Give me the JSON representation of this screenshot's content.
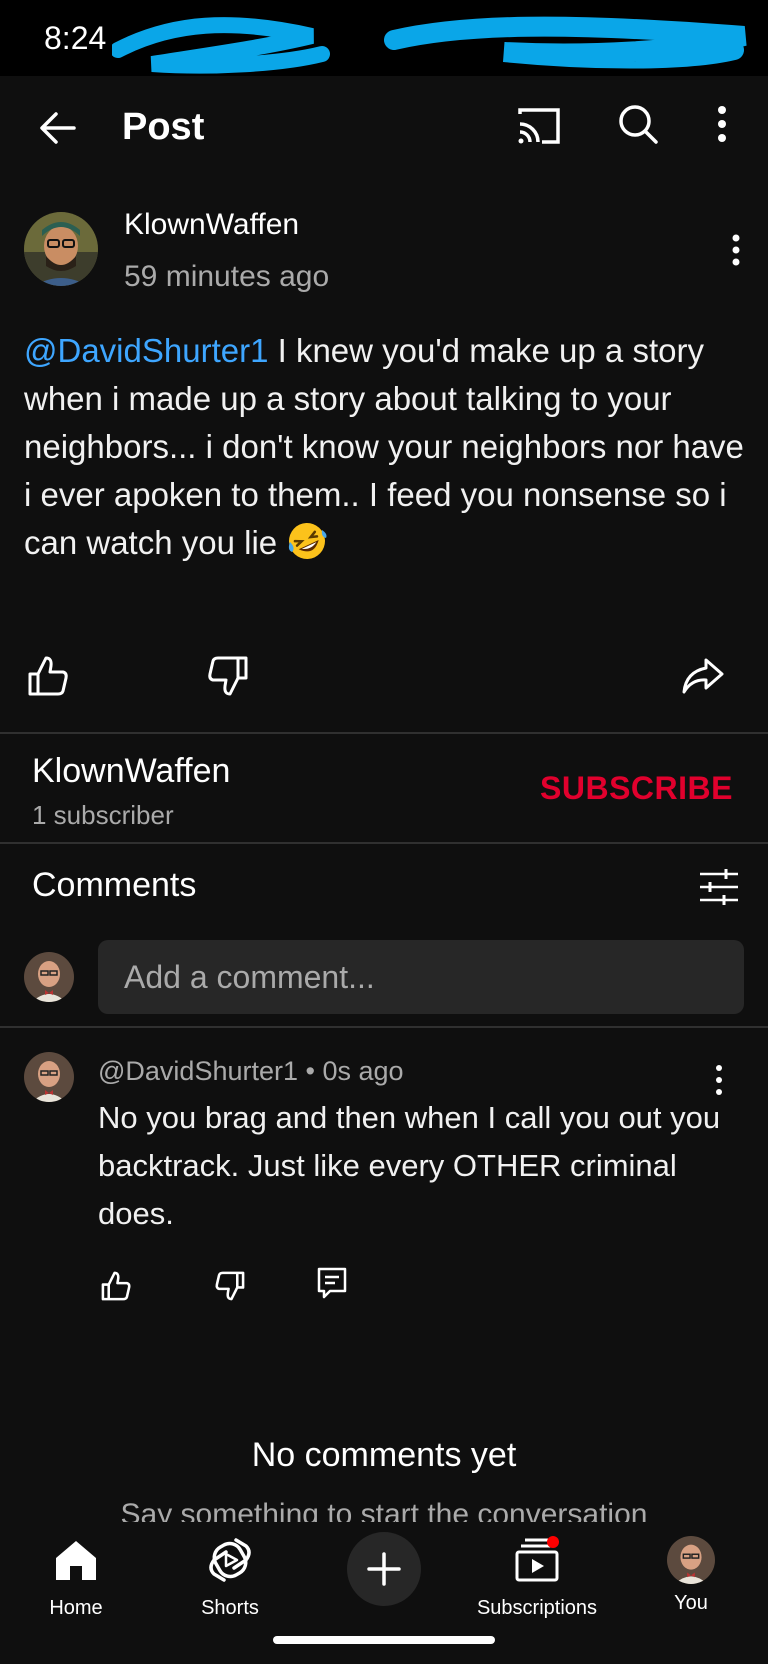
{
  "status": {
    "time": "8:24"
  },
  "header": {
    "title": "Post"
  },
  "post": {
    "author": "KlownWaffen",
    "time": "59 minutes ago",
    "mention": "@DavidShurter1",
    "text": "  I knew you'd make up a story when i made up a story about talking to your neighbors... i don't know your neighbors nor have i ever apoken to them.. I feed you nonsense so i can watch you lie ",
    "emoji_icon": "rofl-emoji"
  },
  "channel": {
    "name": "KlownWaffen",
    "subscribers": "1 subscriber",
    "subscribe_label": "SUBSCRIBE"
  },
  "comments": {
    "title": "Comments",
    "input_placeholder": "Add a comment...",
    "items": [
      {
        "meta": "@DavidShurter1 • 0s ago",
        "text": "No you brag and then when I call you out you backtrack. Just like every OTHER criminal does."
      }
    ],
    "empty_title": "No comments yet",
    "empty_sub": "Say something to start the conversation"
  },
  "nav": {
    "home": "Home",
    "shorts": "Shorts",
    "subscriptions": "Subscriptions",
    "you": "You"
  },
  "colors": {
    "background": "#0f0f0f",
    "mention": "#3ea6ff",
    "subscribe": "#e1002d",
    "notification_dot": "#ff0000"
  }
}
